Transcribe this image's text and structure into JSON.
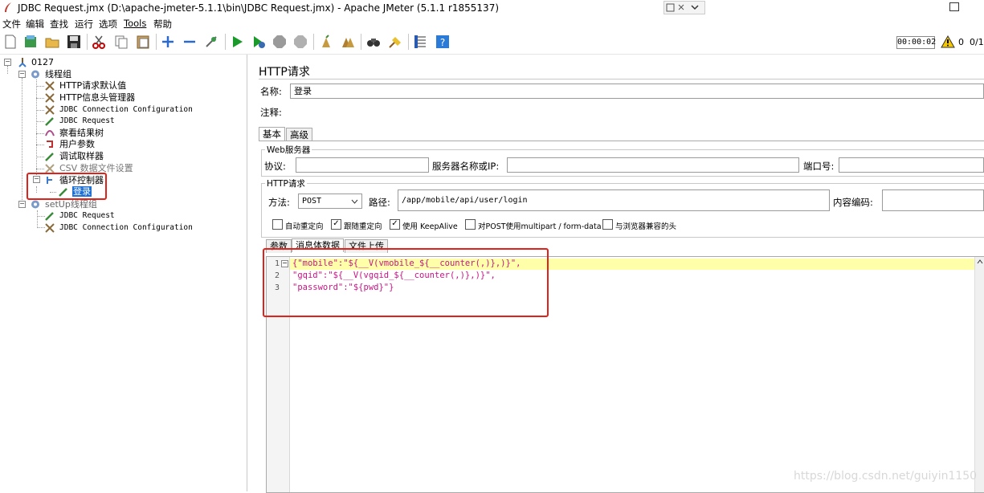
{
  "window": {
    "title": "JDBC Request.jmx (D:\\apache-jmeter-5.1.1\\bin\\JDBC Request.jmx) - Apache JMeter (5.1.1 r1855137)"
  },
  "menu": [
    "文件",
    "编辑",
    "查找",
    "运行",
    "选项",
    "Tools",
    "帮助"
  ],
  "toolbar": {
    "icons": [
      "new-icon",
      "templates-icon",
      "open-icon",
      "save-icon",
      "cut-icon",
      "copy-icon",
      "paste-icon",
      "expand-icon",
      "collapse-icon",
      "toggle-icon",
      "start-icon",
      "start-no-pause-icon",
      "stop-icon",
      "shutdown-icon",
      "clear-icon",
      "clear-all-icon",
      "search-icon",
      "reset-search-icon",
      "function-helper-icon",
      "help-icon"
    ],
    "timer": "00:00:02",
    "warning_count": "0",
    "threads": "0/1"
  },
  "tree": {
    "root": "0127",
    "thread_group": "线程组",
    "children": [
      "HTTP请求默认值",
      "HTTP信息头管理器",
      "JDBC Connection Configuration",
      "JDBC Request",
      "察看结果树",
      "用户参数",
      "调试取样器",
      "CSV 数据文件设置"
    ],
    "loop_controller": "循环控制器",
    "loop_child": "登录",
    "setup_group": "setUp线程组",
    "setup_children": [
      "JDBC Request",
      "JDBC Connection Configuration"
    ]
  },
  "panel": {
    "title": "HTTP请求",
    "name_label": "名称:",
    "name_value": "登录",
    "comment_label": "注释:",
    "tabs": [
      "基本",
      "高级"
    ],
    "web_server": {
      "legend": "Web服务器",
      "protocol_label": "协议:",
      "protocol_value": "",
      "server_label": "服务器名称或IP:",
      "server_value": "",
      "port_label": "端口号:",
      "port_value": ""
    },
    "http_request": {
      "legend": "HTTP请求",
      "method_label": "方法:",
      "method_value": "POST",
      "path_label": "路径:",
      "path_value": "/app/mobile/api/user/login",
      "encoding_label": "内容编码:",
      "encoding_value": ""
    },
    "checkboxes": [
      {
        "label": "自动重定向",
        "checked": false
      },
      {
        "label": "跟随重定向",
        "checked": true
      },
      {
        "label": "使用 KeepAlive",
        "checked": true
      },
      {
        "label": "对POST使用multipart / form-data",
        "checked": false
      },
      {
        "label": "与浏览器兼容的头",
        "checked": false
      }
    ],
    "body_tabs": [
      "参数",
      "消息体数据",
      "文件上传"
    ],
    "code_lines": [
      {
        "num": "1",
        "text": "{\"mobile\":\"${__V(vmobile_${__counter(,)},)}\","
      },
      {
        "num": "2",
        "text": "\"gqid\":\"${__V(vgqid_${__counter(,)},)}\","
      },
      {
        "num": "3",
        "text": "\"password\":\"${pwd}\"}"
      }
    ]
  },
  "watermark": "https://blog.csdn.net/guiyin1150",
  "colors": {
    "selection": "#1e6fd6",
    "highlight_box": "#e0221a",
    "current_line": "#ffffaa",
    "code_text": "#c71585"
  }
}
